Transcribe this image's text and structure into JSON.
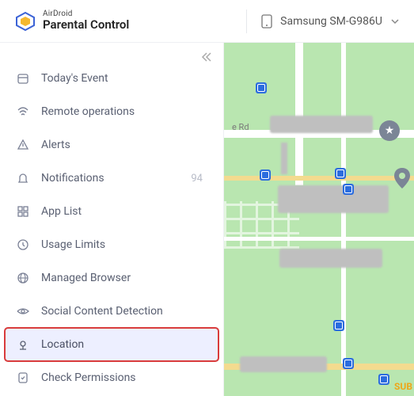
{
  "brand": {
    "sub": "AirDroid",
    "main": "Parental Control"
  },
  "header": {
    "device_name": "Samsung SM-G986U"
  },
  "sidebar": {
    "items": [
      {
        "label": "Today's Event",
        "badge": ""
      },
      {
        "label": "Remote operations",
        "badge": ""
      },
      {
        "label": "Alerts",
        "badge": ""
      },
      {
        "label": "Notifications",
        "badge": "94"
      },
      {
        "label": "App List",
        "badge": ""
      },
      {
        "label": "Usage Limits",
        "badge": ""
      },
      {
        "label": "Managed Browser",
        "badge": ""
      },
      {
        "label": "Social Content Detection",
        "badge": ""
      },
      {
        "label": "Location",
        "badge": ""
      },
      {
        "label": "Check Permissions",
        "badge": ""
      }
    ]
  },
  "map": {
    "road_label": "e Rd",
    "subway_label": "SUB"
  }
}
